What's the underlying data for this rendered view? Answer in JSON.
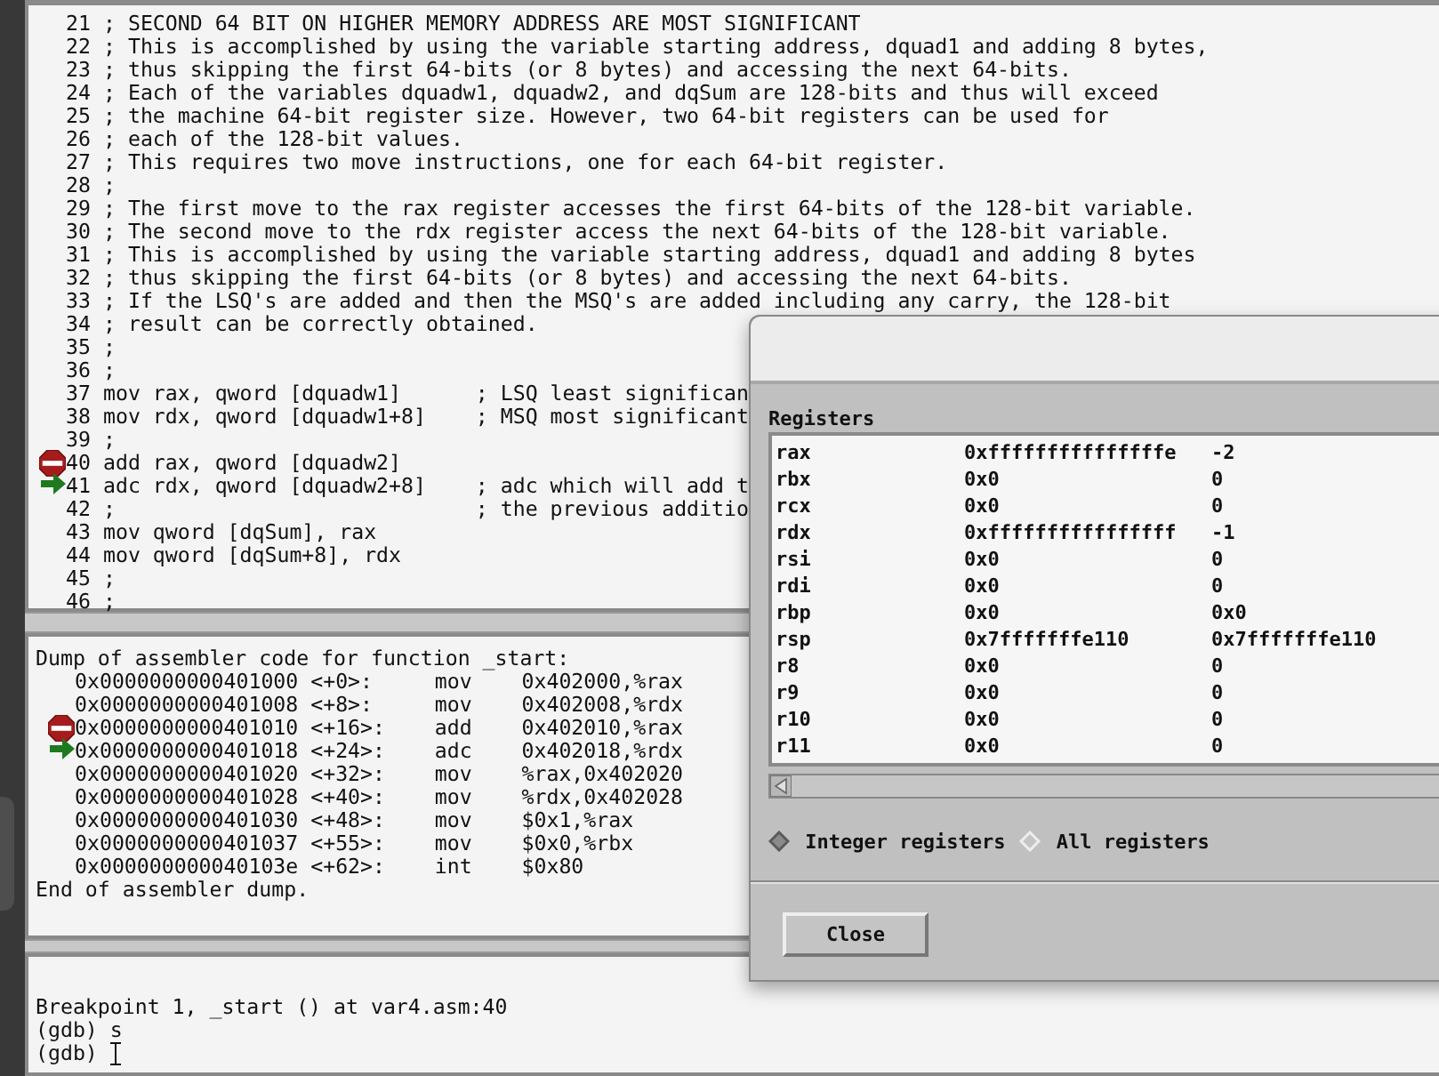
{
  "source_view": {
    "lines": [
      {
        "number": "21",
        "text": "; SECOND 64 BIT ON HIGHER MEMORY ADDRESS ARE MOST SIGNIFICANT",
        "breakpoint": false,
        "current": false
      },
      {
        "number": "22",
        "text": "; This is accomplished by using the variable starting address, dquad1 and adding 8 bytes,",
        "breakpoint": false,
        "current": false
      },
      {
        "number": "23",
        "text": "; thus skipping the first 64-bits (or 8 bytes) and accessing the next 64-bits.",
        "breakpoint": false,
        "current": false
      },
      {
        "number": "24",
        "text": "; Each of the variables dquadw1, dquadw2, and dqSum are 128-bits and thus will exceed",
        "breakpoint": false,
        "current": false
      },
      {
        "number": "25",
        "text": "; the machine 64-bit register size. However, two 64-bit registers can be used for",
        "breakpoint": false,
        "current": false
      },
      {
        "number": "26",
        "text": "; each of the 128-bit values.",
        "breakpoint": false,
        "current": false
      },
      {
        "number": "27",
        "text": "; This requires two move instructions, one for each 64-bit register.",
        "breakpoint": false,
        "current": false
      },
      {
        "number": "28",
        "text": ";",
        "breakpoint": false,
        "current": false
      },
      {
        "number": "29",
        "text": "; The first move to the rax register accesses the first 64-bits of the 128-bit variable.",
        "breakpoint": false,
        "current": false
      },
      {
        "number": "30",
        "text": "; The second move to the rdx register access the next 64-bits of the 128-bit variable.",
        "breakpoint": false,
        "current": false
      },
      {
        "number": "31",
        "text": "; This is accomplished by using the variable starting address, dquad1 and adding 8 bytes",
        "breakpoint": false,
        "current": false
      },
      {
        "number": "32",
        "text": "; thus skipping the first 64-bits (or 8 bytes) and accessing the next 64-bits.",
        "breakpoint": false,
        "current": false
      },
      {
        "number": "33",
        "text": "; If the LSQ's are added and then the MSQ's are added including any carry, the 128-bit",
        "breakpoint": false,
        "current": false
      },
      {
        "number": "34",
        "text": "; result can be correctly obtained.",
        "breakpoint": false,
        "current": false
      },
      {
        "number": "35",
        "text": ";",
        "breakpoint": false,
        "current": false
      },
      {
        "number": "36",
        "text": ";",
        "breakpoint": false,
        "current": false
      },
      {
        "number": "37",
        "text": "mov rax, qword [dquadw1]      ; LSQ least significan",
        "breakpoint": false,
        "current": false
      },
      {
        "number": "38",
        "text": "mov rdx, qword [dquadw1+8]    ; MSQ most significant",
        "breakpoint": false,
        "current": false
      },
      {
        "number": "39",
        "text": ";",
        "breakpoint": false,
        "current": false
      },
      {
        "number": "40",
        "text": "add rax, qword [dquadw2]",
        "breakpoint": true,
        "current": false
      },
      {
        "number": "41",
        "text": "adc rdx, qword [dquadw2+8]    ; adc which will add t",
        "breakpoint": false,
        "current": true
      },
      {
        "number": "42",
        "text": ";                             ; the previous additio",
        "breakpoint": false,
        "current": false
      },
      {
        "number": "43",
        "text": "mov qword [dqSum], rax",
        "breakpoint": false,
        "current": false
      },
      {
        "number": "44",
        "text": "mov qword [dqSum+8], rdx",
        "breakpoint": false,
        "current": false
      },
      {
        "number": "45",
        "text": ";",
        "breakpoint": false,
        "current": false
      },
      {
        "number": "46",
        "text": ";",
        "breakpoint": false,
        "current": false
      }
    ]
  },
  "disassembly": {
    "header": "Dump of assembler code for function _start:",
    "rows": [
      {
        "address": "0x0000000000401000",
        "offset": "<+0>:",
        "mnemonic": "mov",
        "operands": "0x402000,%rax",
        "breakpoint": false,
        "current": false
      },
      {
        "address": "0x0000000000401008",
        "offset": "<+8>:",
        "mnemonic": "mov",
        "operands": "0x402008,%rdx",
        "breakpoint": false,
        "current": false
      },
      {
        "address": "0x0000000000401010",
        "offset": "<+16>:",
        "mnemonic": "add",
        "operands": "0x402010,%rax",
        "breakpoint": true,
        "current": false
      },
      {
        "address": "0x0000000000401018",
        "offset": "<+24>:",
        "mnemonic": "adc",
        "operands": "0x402018,%rdx",
        "breakpoint": false,
        "current": true
      },
      {
        "address": "0x0000000000401020",
        "offset": "<+32>:",
        "mnemonic": "mov",
        "operands": "%rax,0x402020",
        "breakpoint": false,
        "current": false
      },
      {
        "address": "0x0000000000401028",
        "offset": "<+40>:",
        "mnemonic": "mov",
        "operands": "%rdx,0x402028",
        "breakpoint": false,
        "current": false
      },
      {
        "address": "0x0000000000401030",
        "offset": "<+48>:",
        "mnemonic": "mov",
        "operands": "$0x1,%rax",
        "breakpoint": false,
        "current": false
      },
      {
        "address": "0x0000000000401037",
        "offset": "<+55>:",
        "mnemonic": "mov",
        "operands": "$0x0,%rbx",
        "breakpoint": false,
        "current": false
      },
      {
        "address": "0x000000000040103e",
        "offset": "<+62>:",
        "mnemonic": "int",
        "operands": "$0x80",
        "breakpoint": false,
        "current": false
      }
    ],
    "footer": "End of assembler dump."
  },
  "console": {
    "lines": [
      "Breakpoint 1, _start () at var4.asm:40",
      "(gdb) s",
      "(gdb)"
    ]
  },
  "registers_dialog": {
    "title": "Registers",
    "rows": [
      {
        "name": "rax",
        "hex": "0xfffffffffffffffe",
        "natural": "-2"
      },
      {
        "name": "rbx",
        "hex": "0x0",
        "natural": "0"
      },
      {
        "name": "rcx",
        "hex": "0x0",
        "natural": "0"
      },
      {
        "name": "rdx",
        "hex": "0xffffffffffffffff",
        "natural": "-1"
      },
      {
        "name": "rsi",
        "hex": "0x0",
        "natural": "0"
      },
      {
        "name": "rdi",
        "hex": "0x0",
        "natural": "0"
      },
      {
        "name": "rbp",
        "hex": "0x0",
        "natural": "0x0"
      },
      {
        "name": "rsp",
        "hex": "0x7fffffffe110",
        "natural": "0x7fffffffe110"
      },
      {
        "name": "r8",
        "hex": "0x0",
        "natural": "0"
      },
      {
        "name": "r9",
        "hex": "0x0",
        "natural": "0"
      },
      {
        "name": "r10",
        "hex": "0x0",
        "natural": "0"
      },
      {
        "name": "r11",
        "hex": "0x0",
        "natural": "0"
      }
    ],
    "view_options": [
      {
        "label": "Integer registers",
        "selected": true
      },
      {
        "label": "All registers",
        "selected": false
      }
    ],
    "close_button": "Close"
  }
}
